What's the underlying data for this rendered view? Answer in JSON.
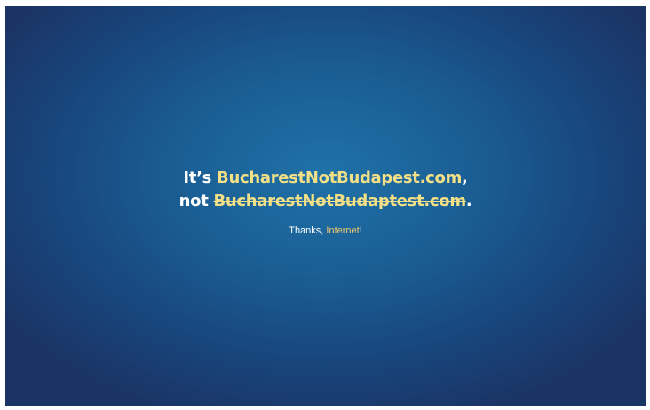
{
  "headline": {
    "line1_prefix": "It’s ",
    "line1_link": "BucharestNotBudapest.com",
    "line1_suffix": ",",
    "line2_prefix": "not ",
    "line2_strike": "BucharestNotBudaptest.com",
    "line2_suffix": "."
  },
  "footer": {
    "thanks_prefix": "Thanks, ",
    "thanks_link": "Internet",
    "thanks_suffix": "!"
  },
  "colors": {
    "background_center": "#1f72a8",
    "background_edge": "#1b3466",
    "highlight": "#f2df86",
    "text": "#ffffff"
  }
}
